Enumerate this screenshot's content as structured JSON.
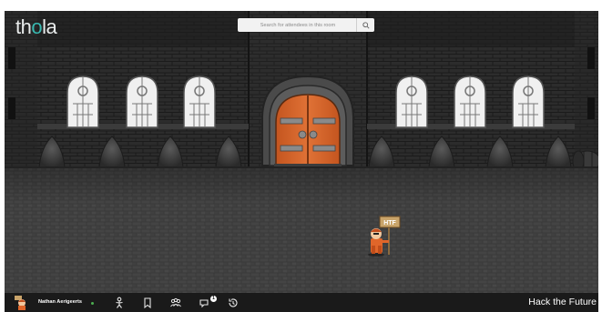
{
  "app": {
    "logo_text_before": "th",
    "logo_text_accent": "o",
    "logo_text_after": "la"
  },
  "search": {
    "placeholder": "Search for attendees in this room",
    "icon": "search-icon"
  },
  "scene": {
    "sign_text": "HTF"
  },
  "bottombar": {
    "user_name": "Nathan Aerigeerts",
    "user_status": "online",
    "notification_count": "1",
    "room_name": "Hack the Future",
    "icons": [
      "emote-icon",
      "bookmark-icon",
      "people-icon",
      "chat-icon",
      "history-icon"
    ]
  },
  "colors": {
    "accent": "#39b8b0",
    "door": "#d2612a",
    "status_online": "#4caf50",
    "bar_bg": "#1a1a1a"
  }
}
